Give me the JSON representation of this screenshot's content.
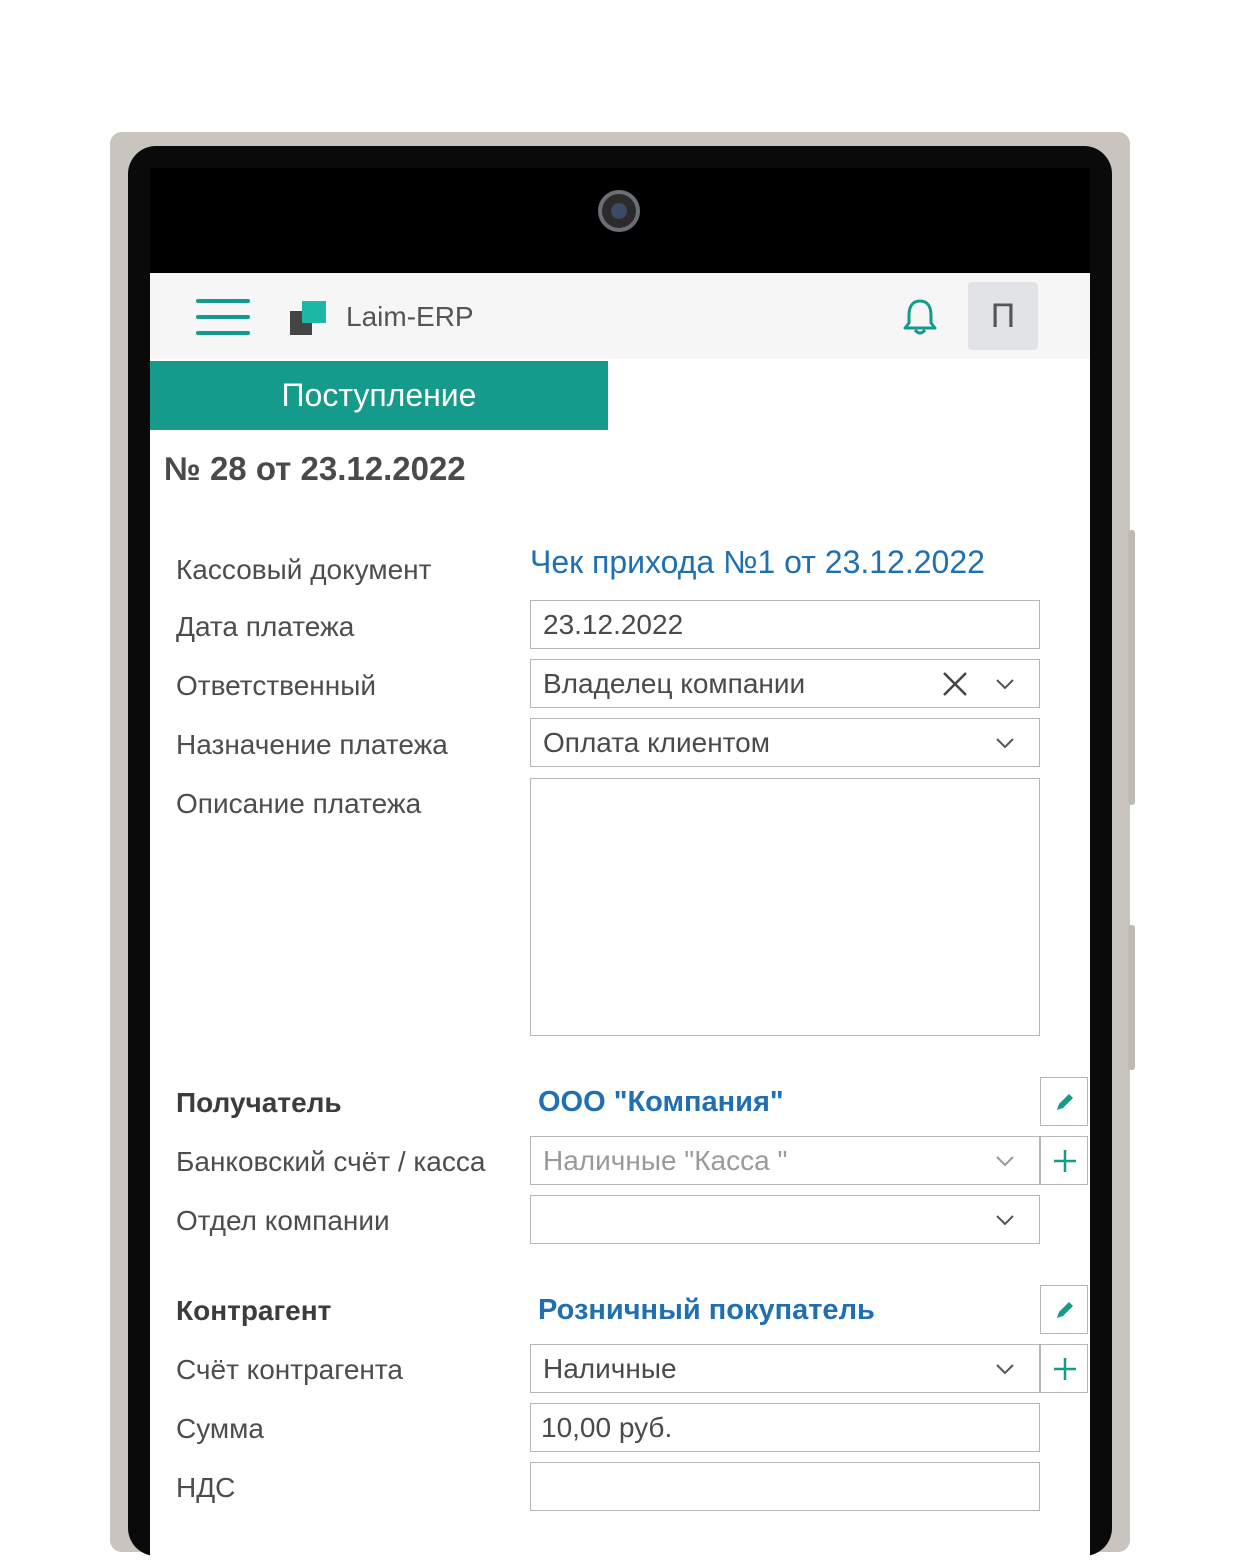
{
  "header": {
    "app_name": "Laim-ERP",
    "user_initial": "П"
  },
  "tab": {
    "label": "Поступление"
  },
  "document": {
    "title": "№ 28 от 23.12.2022"
  },
  "form": {
    "cash_document": {
      "label": "Кассовый документ",
      "value": "Чек прихода №1 от 23.12.2022"
    },
    "payment_date": {
      "label": "Дата платежа",
      "value": "23.12.2022"
    },
    "responsible": {
      "label": "Ответственный",
      "value": "Владелец компании"
    },
    "payment_purpose": {
      "label": "Назначение платежа",
      "value": "Оплата клиентом"
    },
    "payment_description": {
      "label": "Описание платежа",
      "value": ""
    },
    "recipient": {
      "label": "Получатель",
      "value": "ООО \"Компания\""
    },
    "bank_account": {
      "label": "Банковский счёт / касса",
      "value": "Наличные \"Касса \""
    },
    "department": {
      "label": "Отдел компании",
      "value": ""
    },
    "counterparty": {
      "label": "Контрагент",
      "value": "Розничный покупатель"
    },
    "counterparty_account": {
      "label": "Счёт контрагента",
      "value": "Наличные"
    },
    "amount": {
      "label": "Сумма",
      "value": "10,00 руб."
    },
    "vat": {
      "label": "НДС",
      "value": ""
    }
  },
  "colors": {
    "accent": "#149b8c",
    "link": "#1f6fb2"
  }
}
